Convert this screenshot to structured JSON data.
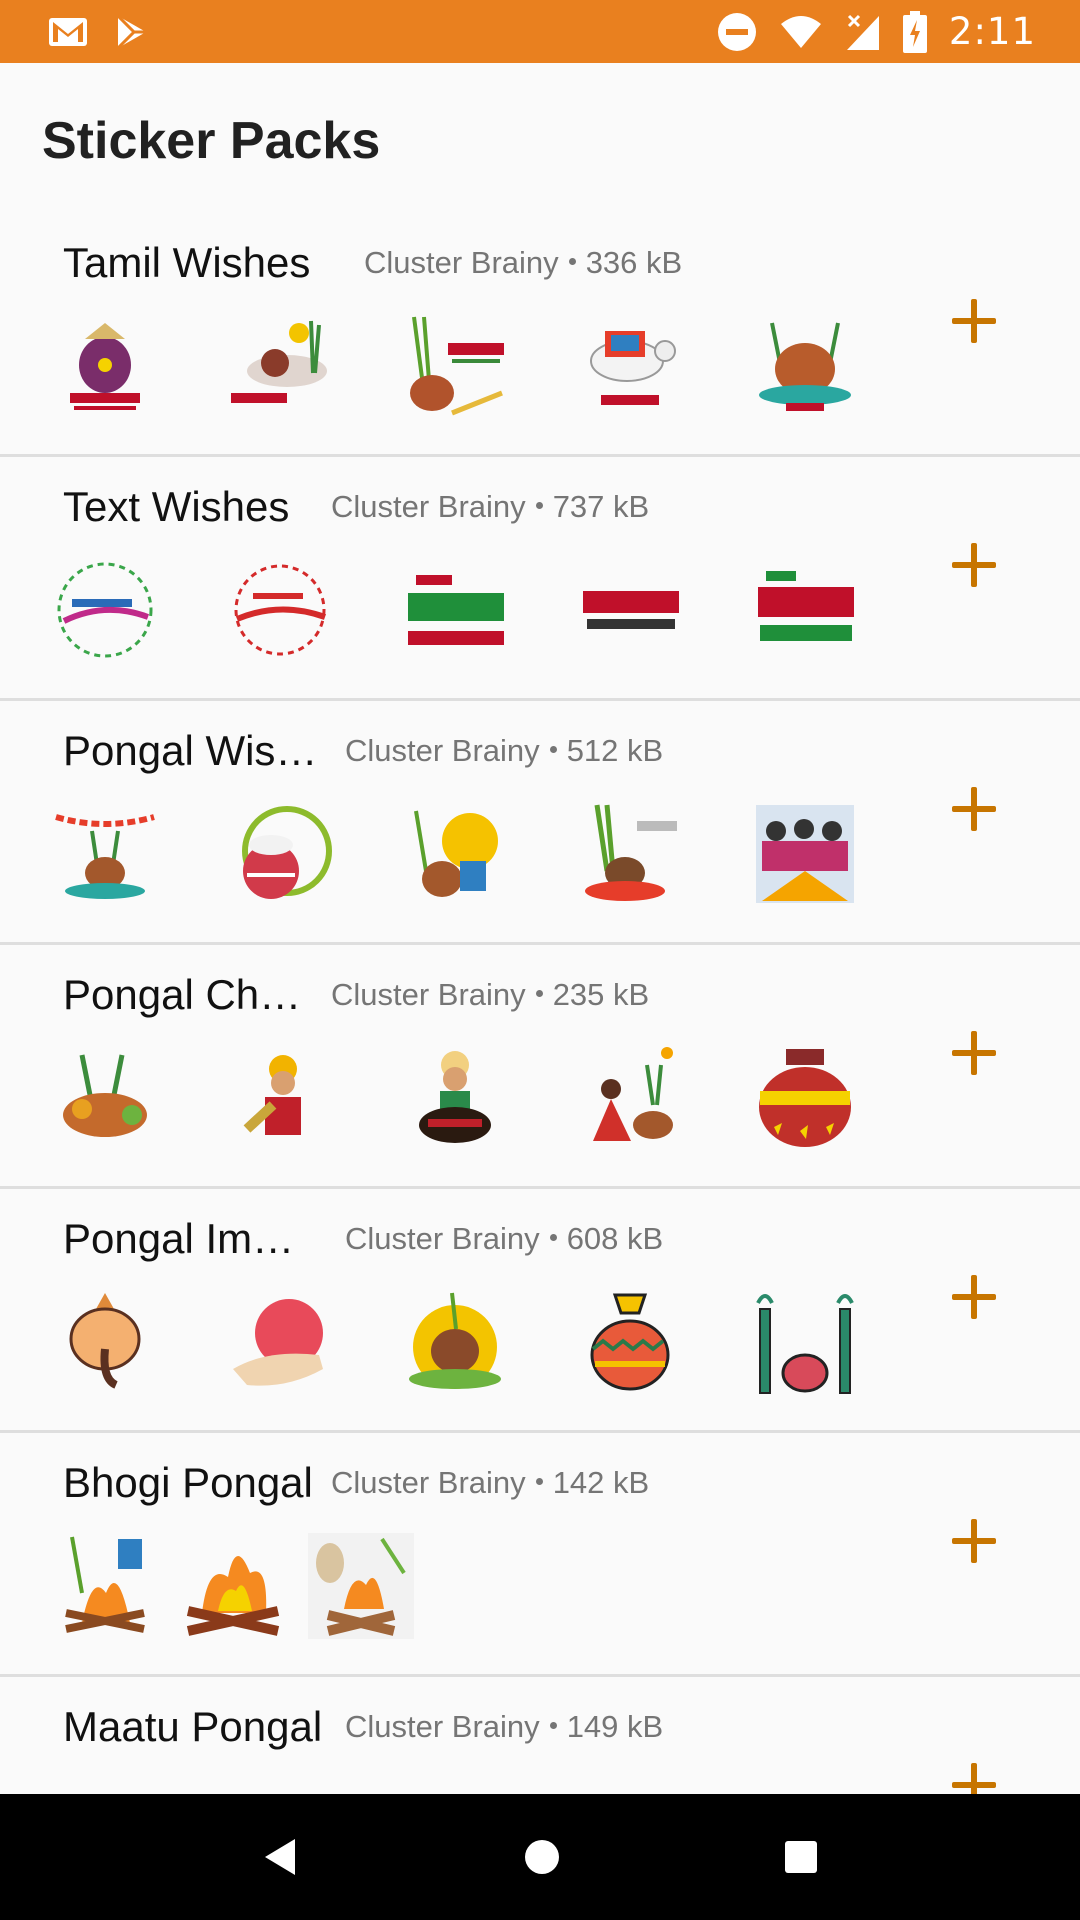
{
  "status_bar": {
    "time": "2:11",
    "background": "#e9801f",
    "icons": [
      "gmail-icon",
      "play-store-icon",
      "do-not-disturb-icon",
      "wifi-icon",
      "cell-signal-off-icon",
      "battery-charging-icon"
    ]
  },
  "header": {
    "title": "Sticker Packs"
  },
  "accent_color": "#c77500",
  "packs": [
    {
      "title": "Tamil Wishes",
      "publisher": "Cluster Brainy",
      "size": "336 kB",
      "stickers": [
        "pongal-pot-sticker",
        "pongal-celebration-sticker",
        "sugarcane-pot-sticker",
        "decorated-cow-sticker",
        "overflowing-pot-sticker"
      ]
    },
    {
      "title": "Text Wishes",
      "publisher": "Cluster Brainy",
      "size": "737 kB",
      "stickers": [
        "happy-pongal-text-sticker",
        "happy-pongal-red-text-sticker",
        "tamil-pongal-green-text-sticker",
        "tamil-pongal-red-text-sticker",
        "tamil-pongal-greetings-sticker"
      ]
    },
    {
      "title": "Pongal Wishes",
      "publisher": "Cluster Brainy",
      "size": "512 kB",
      "stickers": [
        "festive-pot-bunting-sticker",
        "rice-pot-sticker",
        "pongal-sun-pot-sticker",
        "sugarcane-kolam-sticker",
        "crowd-celebration-sticker"
      ]
    },
    {
      "title": "Pongal Characters",
      "publisher": "Cluster Brainy",
      "size": "235 kB",
      "stickers": [
        "harvest-basket-sticker",
        "horn-player-sticker",
        "drummer-sticker",
        "girl-with-pot-sticker",
        "decorated-pot-sticker"
      ]
    },
    {
      "title": "Pongal Images",
      "publisher": "Cluster Brainy",
      "size": "608 kB",
      "stickers": [
        "ganesha-sticker",
        "hand-pot-sticker",
        "sunrise-pot-sticker",
        "patterned-pot-sticker",
        "sugarcane-pot-icon-sticker"
      ]
    },
    {
      "title": "Bhogi Pongal",
      "publisher": "Cluster Brainy",
      "size": "142 kB",
      "stickers": [
        "bhogi-drum-fire-sticker",
        "bonfire-sticker",
        "bonfire-drum-sticker"
      ]
    },
    {
      "title": "Maatu Pongal",
      "publisher": "Cluster Brainy",
      "size": "149 kB",
      "stickers": []
    }
  ],
  "nav": {
    "back": "back-icon",
    "home": "home-icon",
    "recents": "recents-icon"
  }
}
